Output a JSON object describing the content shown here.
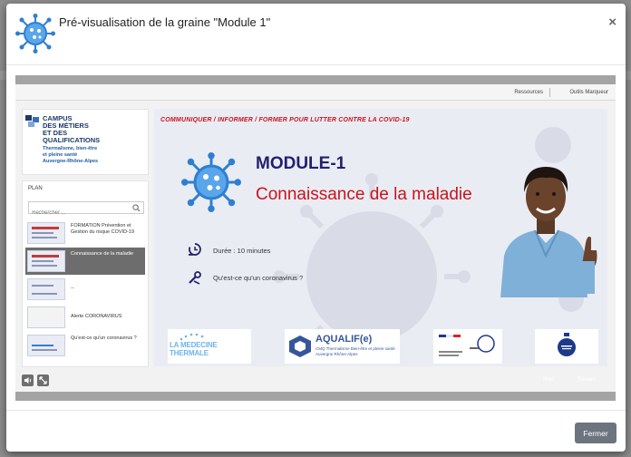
{
  "modal": {
    "title": "Pré-visualisation de la graine \"Module 1\"",
    "close_label": "×",
    "footer_button": "Fermer"
  },
  "player": {
    "topbar": {
      "resources": "Ressources",
      "tools": "Outils Marqueur"
    },
    "logo": {
      "lines": [
        "CAMPUS",
        "DES MÉTIERS",
        "ET DES",
        "QUALIFICATIONS"
      ],
      "sub": [
        "Thermalisme, bien-être",
        "et pleine santé",
        "Auvergne-Rhône-Alpes"
      ]
    },
    "plan": {
      "title": "PLAN",
      "search_placeholder": "Rechercher ...",
      "items": [
        {
          "label": "FORMATION Prévention et Gestion du risque COVID-19",
          "active": false
        },
        {
          "label": "Connaissance de la maladie",
          "active": true
        },
        {
          "label": "--",
          "active": false
        },
        {
          "label": "Alerte CORONAVIRUS",
          "active": false
        },
        {
          "label": "Qu'est-ce qu'un coronavirus ?",
          "active": false
        }
      ]
    },
    "slide": {
      "headline": "COMMUNIQUER / INFORMER / FORMER   POUR LUTTER CONTRE  LA COVID-19",
      "module": "MODULE-1",
      "subtitle": "Connaissance de la maladie",
      "duration": "Durée : 10 minutes",
      "question": "Qu'est-ce qu'un coronavirus ?",
      "partners": {
        "p1": "LA MEDECINE THERMALE",
        "p2": "AQUALIF(e)",
        "p2_sub": "CMQ Thermalisme Bien-être et pleine santé Auvergne Rhône-Alpes"
      }
    },
    "controls": {
      "prev": "Préc.",
      "next": "Suivant"
    }
  },
  "colors": {
    "accent_red": "#c9141d",
    "navy": "#23206d",
    "button_gray": "#6c757d"
  }
}
